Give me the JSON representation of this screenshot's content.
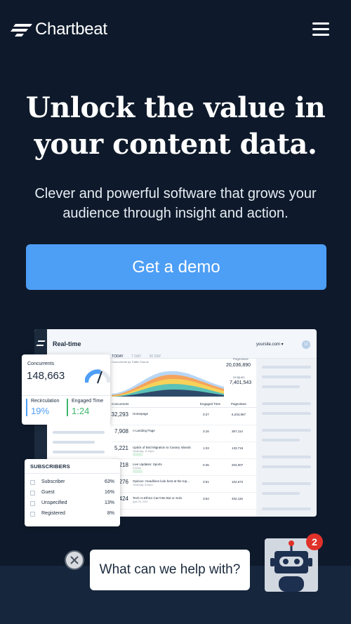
{
  "header": {
    "logo_text": "Chartbeat",
    "menu_icon": "hamburger-menu-icon"
  },
  "hero": {
    "headline_line1": "Unlock the value in",
    "headline_line2": "your content data.",
    "subhead": "Clever and powerful software that grows your audience through insight and action.",
    "cta_label": "Get a demo"
  },
  "dashboard": {
    "title": "Real-time",
    "site_selector": "yoursite.com ▾",
    "user_initial": "U",
    "tabs": [
      "TODAY",
      "7 DAY",
      "30 DAY"
    ],
    "tabs_sub": "Concurrents by Traffic Source",
    "pageviews_label": "Pageviews",
    "pageviews_value": "20,036,890",
    "uniques_label": "Uniques",
    "uniques_value": "7,401,543",
    "table_headers": {
      "concurrents": "Concurrents",
      "engaged": "Engaged Time",
      "pageviews": "Pageviews"
    },
    "rows": [
      {
        "num": "32,293",
        "title": "Homepage",
        "sub": "",
        "engaged": "0:27",
        "pageviews": "6,234,967"
      },
      {
        "num": "7,908",
        "title": "A Landing Page",
        "sub": "",
        "engaged": "3:16",
        "pageviews": "357,114"
      },
      {
        "num": "5,221",
        "title": "Uptick of Bird Migration to Canary Islands",
        "sub": "Yesterday, 11:25pm",
        "engaged": "1:23",
        "pageviews": "133,716"
      },
      {
        "num": "5,218",
        "title": "Live Updates: Sports",
        "sub": "9:02am",
        "engaged": "0:45",
        "pageviews": "204,007"
      },
      {
        "num": "3,276",
        "title": "Opinion: Headlines look best at the top...",
        "sub": "Yesterday, 8:35pm",
        "engaged": "3:51",
        "pageviews": "102,672"
      },
      {
        "num": "2,424",
        "title": "Tech AI Ethics Can't Be But or Solo",
        "sub": "April 20, 2021",
        "engaged": "3:54",
        "pageviews": "402,115"
      }
    ]
  },
  "concurrents_card": {
    "label": "Concurrents",
    "value": "148,663",
    "recirculation_label": "Recirculation",
    "recirculation_value": "19%",
    "engaged_label": "Engaged Time",
    "engaged_value": "1:24"
  },
  "subscribers_card": {
    "title": "SUBSCRIBERS",
    "rows": [
      {
        "name": "Subscriber",
        "pct": "63%"
      },
      {
        "name": "Guest",
        "pct": "16%"
      },
      {
        "name": "Unspecified",
        "pct": "13%"
      },
      {
        "name": "Registered",
        "pct": "8%"
      }
    ]
  },
  "chat": {
    "prompt": "What can we help with?",
    "badge_count": "2",
    "close_icon": "close-icon",
    "bot_icon": "robot-icon"
  },
  "colors": {
    "background": "#0e1a2b",
    "cta": "#4d9ef5",
    "badge": "#e0322a",
    "engaged": "#3db86a"
  }
}
